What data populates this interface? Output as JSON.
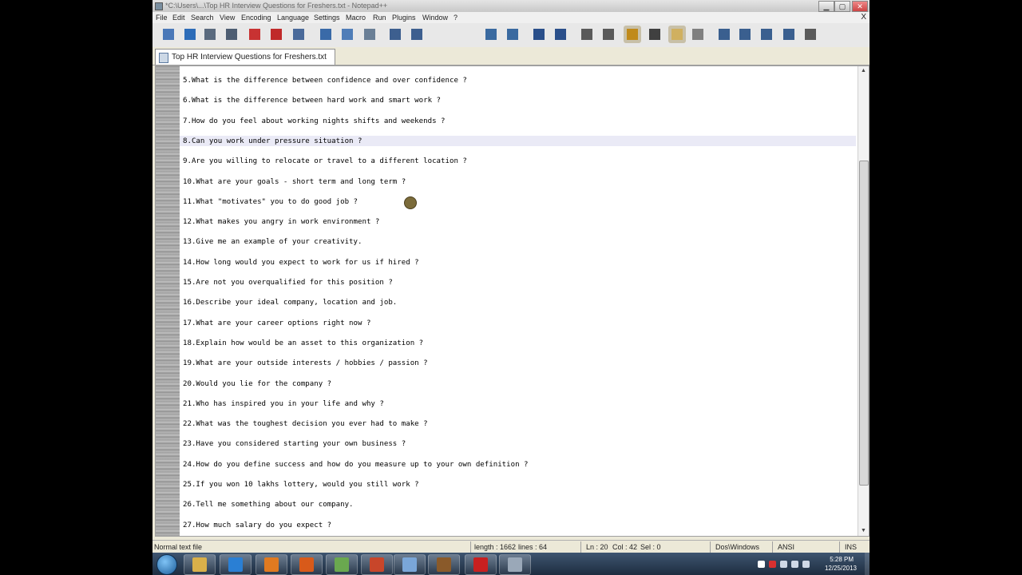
{
  "window": {
    "title": "*C:\\Users\\...\\Top HR Interview Questions for Freshers.txt - Notepad++",
    "min": "▁",
    "max": "▢",
    "close": "✕"
  },
  "menu": {
    "items": [
      "File",
      "Edit",
      "Search",
      "View",
      "Encoding",
      "Language",
      "Settings",
      "Macro",
      "Run",
      "Plugins",
      "Window",
      "?"
    ],
    "close": "X"
  },
  "toolbar": {
    "icons": [
      {
        "name": "new-file-icon",
        "color": "#4a78b8"
      },
      {
        "name": "open-file-icon",
        "color": "#2d6cb8"
      },
      {
        "name": "save-icon",
        "color": "#5a6a7e"
      },
      {
        "name": "save-all-icon",
        "color": "#4d5d72"
      },
      {
        "name": "close-icon",
        "color": "#c83232"
      },
      {
        "name": "close-all-icon",
        "color": "#c02a2a"
      },
      {
        "name": "print-icon",
        "color": "#4a6a9a"
      },
      {
        "name": "cut-icon",
        "color": "#3a6aa8"
      },
      {
        "name": "copy-icon",
        "color": "#4f7db8"
      },
      {
        "name": "paste-icon",
        "color": "#6a7f96"
      },
      {
        "name": "undo-icon",
        "color": "#3d5f8f"
      },
      {
        "name": "redo-icon",
        "color": "#3d5f8f"
      },
      {
        "name": "find-icon",
        "color": "#3a6aa0"
      },
      {
        "name": "replace-icon",
        "color": "#3a6aa0"
      },
      {
        "name": "zoom-in-icon",
        "color": "#2a4f8a"
      },
      {
        "name": "zoom-out-icon",
        "color": "#2a4f8a"
      },
      {
        "name": "sync-vertical-icon",
        "color": "#5a5a5a"
      },
      {
        "name": "sync-horizontal-icon",
        "color": "#5a5a5a"
      },
      {
        "name": "word-wrap-icon",
        "color": "#c08a1a"
      },
      {
        "name": "show-all-chars-icon",
        "color": "#404040"
      },
      {
        "name": "indent-guide-icon",
        "color": "#d0b060"
      },
      {
        "name": "doc-map-icon",
        "color": "#808080"
      },
      {
        "name": "record-macro-icon",
        "color": "#3a5f8f"
      },
      {
        "name": "stop-macro-icon",
        "color": "#3a5f8f"
      },
      {
        "name": "play-macro-icon",
        "color": "#3a5f8f"
      },
      {
        "name": "run-macro-multiple-icon",
        "color": "#3a5f8f"
      },
      {
        "name": "save-macro-icon",
        "color": "#5a5a5a"
      }
    ]
  },
  "tab": {
    "label": "Top HR Interview Questions for Freshers.txt"
  },
  "editor": {
    "lines": [
      "5.What is the difference between confidence and over confidence ?",
      "6.What is the difference between hard work and smart work ?",
      "7.How do you feel about working nights shifts and weekends ?",
      "8.Can you work under pressure situation ?",
      "9.Are you willing to relocate or travel to a different location ?",
      "10.What are your goals - short term and long term ?",
      "11.What \"motivates\" you to do good job ?",
      "12.What makes you angry in work environment ?",
      "13.Give me an example of your creativity.",
      "14.How long would you expect to work for us if hired ?",
      "15.Are not you overqualified for this position ?",
      "16.Describe your ideal company, location and job.",
      "17.What are your career options right now ?",
      "18.Explain how would be an asset to this organization ?",
      "19.What are your outside interests / hobbies / passion ?",
      "20.Would you lie for the company ?",
      "21.Who has inspired you in your life and why ?",
      "22.What was the toughest decision you ever had to make ?",
      "23.Have you considered starting your own business ?",
      "24.How do you define success and how do you measure up to your own definition ?",
      "25.If you won 10 lakhs lottery, would you still work ?",
      "26.Tell me something about our company.",
      "27.How much salary do you expect ?"
    ],
    "current_line_index": 3
  },
  "scrollbar": {
    "up": "▲",
    "down": "▼"
  },
  "status": {
    "file_type": "Normal text file",
    "length": "length : 1662",
    "lines": "lines : 64",
    "ln": "Ln : 20",
    "col": "Col : 42",
    "sel": "Sel : 0",
    "eol": "Dos\\Windows",
    "encoding": "ANSI",
    "mode": "INS"
  },
  "taskbar": {
    "apps": [
      {
        "name": "explorer-icon",
        "color": "#d9b04a"
      },
      {
        "name": "ie-icon",
        "color": "#2a7fd4"
      },
      {
        "name": "media-player-icon",
        "color": "#e07a20"
      },
      {
        "name": "firefox-icon",
        "color": "#d85a1a"
      },
      {
        "name": "notepad-plus-plus-icon",
        "color": "#6aa84f"
      },
      {
        "name": "powerpoint-icon",
        "color": "#c8462a"
      },
      {
        "name": "document-icon",
        "color": "#7aa6d8"
      },
      {
        "name": "camtasia-icon",
        "color": "#8a5a2a"
      },
      {
        "name": "acrobat-icon",
        "color": "#c82020"
      },
      {
        "name": "editor-icon",
        "color": "#9aa8b8"
      }
    ],
    "time": "5:28 PM",
    "date": "12/25/2013",
    "tray_icons": [
      {
        "name": "show-hidden-icon",
        "color": "#ffffff"
      },
      {
        "name": "app-tray-icon",
        "color": "#d83030"
      },
      {
        "name": "volume-icon",
        "color": "#cfd8e6"
      },
      {
        "name": "network-icon",
        "color": "#cfd8e6"
      },
      {
        "name": "flag-icon",
        "color": "#cfd8e6"
      }
    ]
  }
}
